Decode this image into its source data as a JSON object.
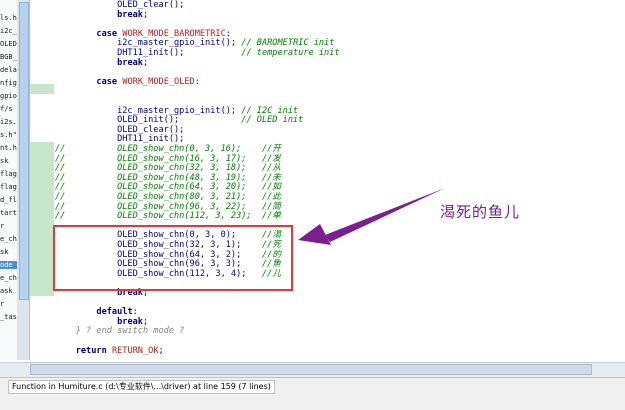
{
  "tree_items": [
    "ls.h\"",
    "i2c_",
    "OLED",
    "BGB_",
    "dela",
    "nfig",
    "gpio",
    "f/s",
    "i2s.",
    "s.h\"",
    "nt.h",
    "sk",
    "flag",
    "flag",
    "d_fl",
    "tart",
    "r",
    "e_ch",
    "sk",
    "ode",
    "e_ch",
    "ask",
    "r",
    "_tas"
  ],
  "code_lines": [
    {
      "text": "            OLED_clear();"
    },
    {
      "text": "            break;"
    },
    {
      "text": ""
    },
    {
      "text": "        case WORK_MODE_BAROMETRIC:"
    },
    {
      "text": "            i2c_master_gpio_init(); // BAROMETRIC init"
    },
    {
      "text": "            DHT11_init();           // temperature init"
    },
    {
      "text": "            break;"
    },
    {
      "text": ""
    },
    {
      "text": "        case WORK_MODE_OLED:"
    },
    {
      "text": ""
    },
    {
      "text": ""
    },
    {
      "text": "            i2c_master_gpio_init(); // I2C init"
    },
    {
      "text": "            OLED_init();            // OLED init"
    },
    {
      "text": "            OLED_clear();"
    },
    {
      "text": "            DHT11_init();"
    },
    {
      "text": "//          OLED_show_chn(0, 3, 16);    //开"
    },
    {
      "text": "//          OLED_show_chn(16, 3, 17);   //发"
    },
    {
      "text": "//          OLED_show_chn(32, 3, 18);   //从"
    },
    {
      "text": "//          OLED_show_chn(48, 3, 19);   //未"
    },
    {
      "text": "//          OLED_show_chn(64, 3, 20);   //如"
    },
    {
      "text": "//          OLED_show_chn(80, 3, 21);   //此"
    },
    {
      "text": "//          OLED_show_chn(96, 3, 22);   //简"
    },
    {
      "text": "//          OLED_show_chn(112, 3, 23);  //单"
    },
    {
      "text": ""
    },
    {
      "text": "            OLED_show_chn(0, 3, 0);     //渴"
    },
    {
      "text": "            OLED_show_chn(32, 3, 1);    //死"
    },
    {
      "text": "            OLED_show_chn(64, 3, 2);    //的"
    },
    {
      "text": "            OLED_show_chn(96, 3, 3);    //鱼"
    },
    {
      "text": "            OLED_show_chn(112, 3, 4);   //儿"
    },
    {
      "text": ""
    },
    {
      "text": "            break;"
    },
    {
      "text": ""
    },
    {
      "text": "        default:"
    },
    {
      "text": "            break;"
    },
    {
      "text": "    } ? end switch mode ?"
    },
    {
      "text": ""
    },
    {
      "text": "    return RETURN_OK;"
    }
  ],
  "annotation": {
    "text": "渴死的鱼儿",
    "color": "#7a1f8c"
  },
  "status": {
    "text": "Function in Humiture.c (d:\\专业软件\\...\\driver) at line 159 (7 lines)"
  },
  "colors": {
    "keyword": "#000080",
    "comment": "#008000",
    "constant": "#b22222",
    "highlight_box": "#e23a3a",
    "gutter_stripe": "#c8e6c9"
  }
}
